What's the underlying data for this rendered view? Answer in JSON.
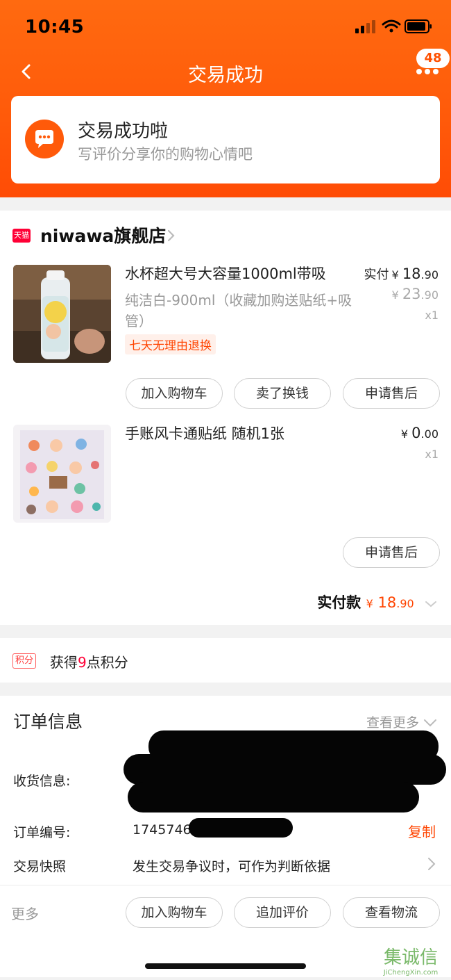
{
  "status_bar": {
    "time": "10:45"
  },
  "nav": {
    "title": "交易成功",
    "message_count": "48"
  },
  "banner": {
    "title": "交易成功啦",
    "subtitle": "写评价分享你的购物心情吧"
  },
  "store": {
    "badge": "天猫",
    "name": "niwawa旗舰店",
    "items": [
      {
        "title": "水杯超大号大容量1000ml带吸",
        "sku": "纯洁白-900ml（收藏加购送贴纸+吸管）",
        "tag": "七天无理由退换",
        "paid_label": "实付",
        "currency": "¥",
        "price_int": "18",
        "price_dec": ".90",
        "orig_price_int": "23",
        "orig_price_dec": ".90",
        "qty": "x1",
        "buttons": [
          "加入购物车",
          "卖了换钱",
          "申请售后"
        ]
      },
      {
        "title": "手账风卡通贴纸  随机1张",
        "currency": "¥",
        "price_int": "0",
        "price_dec": ".00",
        "qty": "x1",
        "buttons": [
          "申请售后"
        ]
      }
    ],
    "total_label": "实付款",
    "total_currency": "¥",
    "total_int": "18",
    "total_dec": ".90"
  },
  "points": {
    "tag": "积分",
    "prefix": "获得",
    "value": "9",
    "suffix": "点积分"
  },
  "order_info": {
    "title": "订单信息",
    "more": "查看更多",
    "shipping_label": "收货信息:",
    "order_no_label": "订单编号:",
    "order_no_value": "17457460",
    "copy": "复制",
    "snapshot_label": "交易快照",
    "snapshot_value": "发生交易争议时，可作为判断依据",
    "more_label": "更多",
    "footer_buttons": [
      "加入购物车",
      "追加评价",
      "查看物流"
    ]
  },
  "watermark": {
    "top": "集诚信",
    "bottom": "JiChengXin.com"
  },
  "colors": {
    "brand_orange": "#ff5000",
    "price_orange": "#ff4400",
    "tmall_red": "#ff0036"
  }
}
